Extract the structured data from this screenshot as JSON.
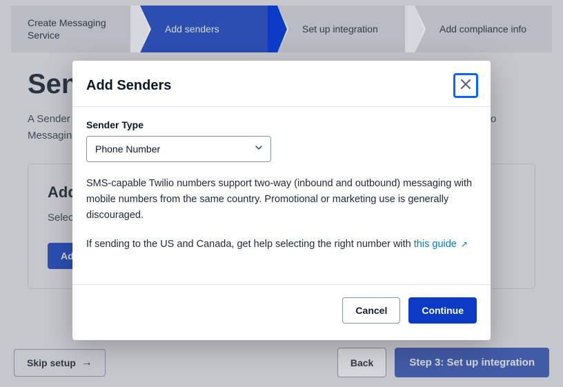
{
  "stepper": {
    "s1": "Create Messaging Service",
    "s2": "Add senders",
    "s3": "Set up integration",
    "s4": "Add compliance info"
  },
  "page": {
    "title": "Sender Pool",
    "desc": "A Sender represents a channel, number, or identity used to send and receive messages with the Twilio Messaging Service. Adding a sender to the pool enables automatic failover for your use case.",
    "panel_title": "Add Senders",
    "panel_desc": "Select from available sender types. You can mix multiple types in one pool or keep it for one app.",
    "add_btn": "Add Senders"
  },
  "bottom": {
    "skip": "Skip setup",
    "back": "Back",
    "next": "Step 3: Set up integration"
  },
  "modal": {
    "title": "Add Senders",
    "label": "Sender Type",
    "selected": "Phone Number",
    "help1": "SMS-capable Twilio numbers support two-way (inbound and outbound) messaging with mobile numbers from the same country. Promotional or marketing use is generally discouraged.",
    "help2_pre": "If sending to the US and Canada, get help selecting the right number with ",
    "help2_link": "this guide",
    "cancel": "Cancel",
    "continue": "Continue"
  }
}
